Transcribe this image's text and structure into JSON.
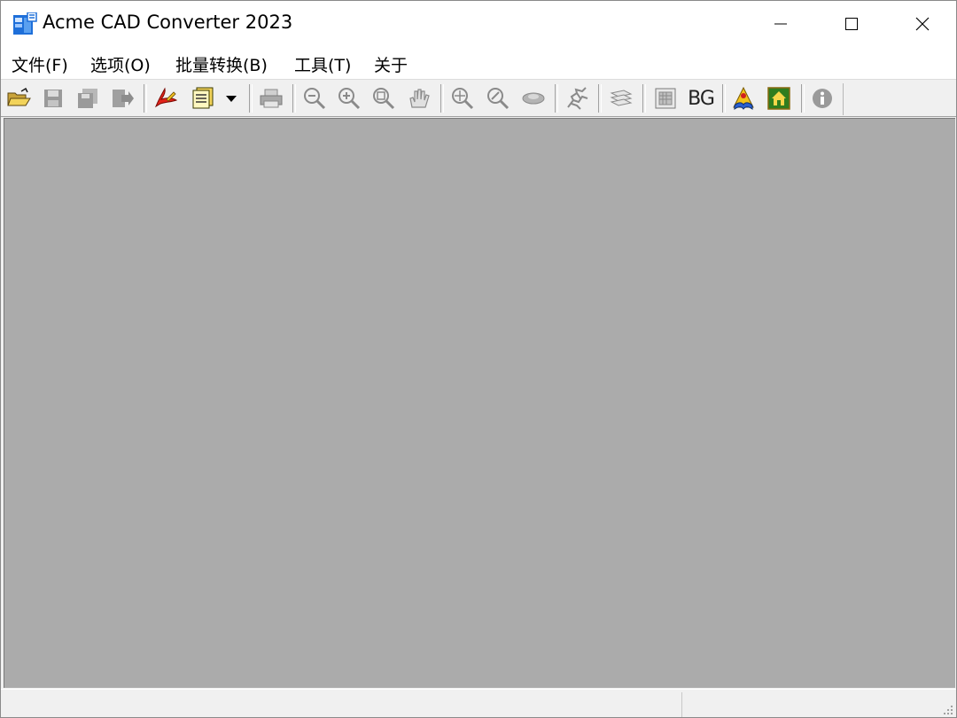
{
  "window": {
    "title": "Acme CAD Converter 2023",
    "controls": [
      "minimize-icon",
      "maximize-icon",
      "close-icon"
    ]
  },
  "menu": [
    {
      "label": "文件(F)"
    },
    {
      "label": "选项(O)"
    },
    {
      "label": "批量转换(B)"
    },
    {
      "label": "工具(T)"
    },
    {
      "label": "关于"
    }
  ],
  "toolbar": {
    "buttons": [
      {
        "icon": "open-folder-icon",
        "enabled": true
      },
      {
        "icon": "save-icon",
        "enabled": false
      },
      {
        "icon": "save-all-icon",
        "enabled": false
      },
      {
        "icon": "export-icon",
        "enabled": false
      },
      {
        "icon": "pdf-convert-icon",
        "enabled": true
      },
      {
        "icon": "batch-convert-icon",
        "enabled": true
      },
      {
        "icon": "print-icon",
        "enabled": false
      },
      {
        "icon": "zoom-out-icon",
        "enabled": false
      },
      {
        "icon": "zoom-in-icon",
        "enabled": false
      },
      {
        "icon": "zoom-window-icon",
        "enabled": false
      },
      {
        "icon": "pan-hand-icon",
        "enabled": false
      },
      {
        "icon": "zoom-extents-icon",
        "enabled": false
      },
      {
        "icon": "zoom-realtime-icon",
        "enabled": false
      },
      {
        "icon": "view-icon",
        "enabled": false
      },
      {
        "icon": "redraw-icon",
        "enabled": false
      },
      {
        "icon": "layers-icon",
        "enabled": false
      },
      {
        "icon": "background-grid-icon",
        "enabled": false
      },
      {
        "icon": "help-book-icon",
        "enabled": true
      },
      {
        "icon": "home-icon",
        "enabled": true
      },
      {
        "icon": "info-icon",
        "enabled": false
      }
    ],
    "bg_label": "BG"
  },
  "statusbar": {
    "left_text": "",
    "right_text": ""
  }
}
